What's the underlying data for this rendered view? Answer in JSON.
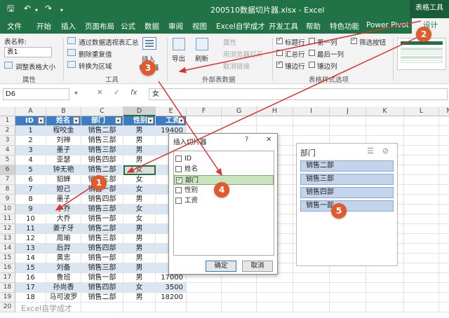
{
  "titlebar": {
    "save_icon": "save-icon",
    "undo_icon": "undo-icon",
    "redo_icon": "redo-icon",
    "doc_title": "200510数据切片器.xlsx  -  Excel",
    "context_label": "表格工具"
  },
  "tabs": [
    "文件",
    "开始",
    "插入",
    "页面布局",
    "公式",
    "数据",
    "审阅",
    "视图",
    "Excel自学成才",
    "开发工具",
    "帮助",
    "特色功能",
    "Power Pivot",
    "设计"
  ],
  "ribbon": {
    "table_name_label": "表名称:",
    "table_name_value": "表1",
    "resize_label": "调整表格大小",
    "group_properties": "属性",
    "summarize_pivot": "通过数据透视表汇总",
    "remove_duplicates": "删除重复值",
    "convert_range": "转换为区域",
    "insert_slicer": "插入",
    "insert_slicer2": "切片器",
    "group_tools": "工具",
    "export": "导出",
    "refresh": "刷新",
    "ext_props": "属性",
    "ext_open_browser": "用浏览器打开",
    "ext_unlink": "取消链接",
    "group_external": "外部表数据",
    "opt_header_row": "标题行",
    "opt_first_col": "第一列",
    "opt_filter_btn": "筛选按钮",
    "opt_total_row": "汇总行",
    "opt_last_col": "最后一列",
    "opt_banded_rows": "镶边行",
    "opt_banded_cols": "镶边列",
    "group_style_options": "表格样式选项"
  },
  "formula": {
    "namebox": "D6",
    "cancel_icon": "✕",
    "enter_icon": "✓",
    "fx_label": "fx",
    "value": "女"
  },
  "sheet": {
    "columns": [
      "A",
      "B",
      "C",
      "D",
      "E",
      "F",
      "G",
      "H",
      "I",
      "J",
      "K",
      "L",
      "M"
    ],
    "headers": [
      "ID",
      "姓名",
      "部门",
      "性别",
      "工资"
    ],
    "rows": [
      [
        "1",
        "程咬金",
        "销售二部",
        "男",
        "19400"
      ],
      [
        "2",
        "刘禅",
        "销售三部",
        "男",
        ""
      ],
      [
        "3",
        "墨子",
        "销售三部",
        "男",
        ""
      ],
      [
        "4",
        "亚瑟",
        "销售四部",
        "男",
        ""
      ],
      [
        "5",
        "钟无艳",
        "销售二部",
        "女",
        ""
      ],
      [
        "6",
        "貂蝉",
        "销售三部",
        "女",
        ""
      ],
      [
        "7",
        "妲己",
        "销售一部",
        "女",
        ""
      ],
      [
        "8",
        "墨子",
        "销售四部",
        "男",
        ""
      ],
      [
        "9",
        "小乔",
        "销售三部",
        "女",
        ""
      ],
      [
        "10",
        "大乔",
        "销售一部",
        "女",
        ""
      ],
      [
        "11",
        "姜子牙",
        "销售二部",
        "男",
        ""
      ],
      [
        "12",
        "周瑜",
        "销售三部",
        "男",
        ""
      ],
      [
        "13",
        "后羿",
        "销售四部",
        "男",
        ""
      ],
      [
        "14",
        "黄忠",
        "销售一部",
        "男",
        ""
      ],
      [
        "15",
        "刘备",
        "销售三部",
        "男",
        ""
      ],
      [
        "16",
        "鲁班",
        "销售一部",
        "男",
        "17000"
      ],
      [
        "17",
        "孙尚香",
        "销售四部",
        "女",
        "3500"
      ],
      [
        "18",
        "马可波罗",
        "销售二部",
        "男",
        "18200"
      ]
    ],
    "row_numbers": [
      "1",
      "2",
      "3",
      "4",
      "5",
      "6",
      "7",
      "8",
      "9",
      "10",
      "11",
      "12",
      "13",
      "14",
      "15",
      "16",
      "17",
      "18",
      "19",
      "20"
    ]
  },
  "dialog": {
    "title": "插入切片器",
    "help": "?",
    "close": "✕",
    "fields": [
      {
        "label": "ID",
        "checked": false
      },
      {
        "label": "姓名",
        "checked": false
      },
      {
        "label": "部门",
        "checked": true
      },
      {
        "label": "性别",
        "checked": false
      },
      {
        "label": "工资",
        "checked": false
      }
    ],
    "ok": "确定",
    "cancel": "取消"
  },
  "slicer": {
    "title": "部门",
    "items": [
      "销售二部",
      "销售三部",
      "销售四部",
      "销售一部"
    ]
  },
  "badges": [
    "1",
    "2",
    "3",
    "4",
    "5"
  ],
  "watermark": "Excel自学成才",
  "colors": {
    "excel_green": "#217346",
    "table_header": "#3e7cc1",
    "band": "#dbe6f3",
    "annotation": "#e05a2b"
  }
}
